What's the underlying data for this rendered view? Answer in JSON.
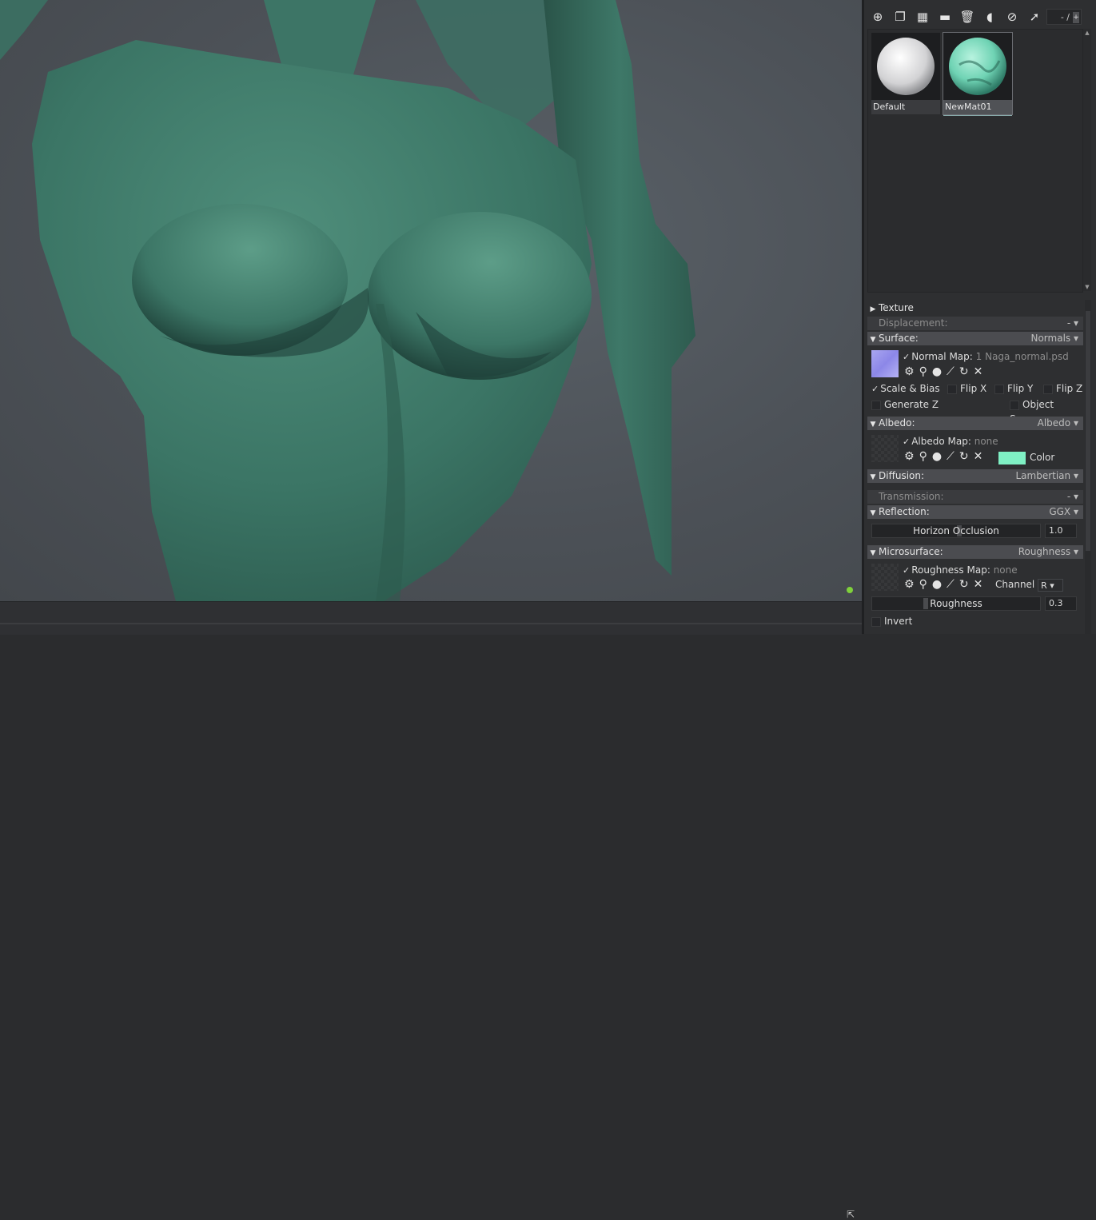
{
  "viewport": {
    "status_color": "#7fd13b",
    "popout_icon": "popout-icon"
  },
  "materials_panel": {
    "toolbar": {
      "icons": [
        "add-material-icon",
        "duplicate-icon",
        "checker-icon",
        "folder-icon",
        "trash-icon",
        "select-object-icon",
        "apply-icon",
        "export-icon"
      ],
      "counter": "- /",
      "counter_plus": "+"
    },
    "materials": [
      {
        "name": "Default",
        "selected": false
      },
      {
        "name": "NewMat01",
        "selected": true
      }
    ]
  },
  "properties": {
    "texture": {
      "label": "Texture"
    },
    "displacement": {
      "label": "Displacement:",
      "value": "-"
    },
    "surface": {
      "label": "Surface:",
      "value": "Normals",
      "normal_map_label": "Normal Map:",
      "normal_map_file": "1 Naga_normal.psd",
      "scale_bias": "Scale & Bias",
      "flip_x": "Flip X",
      "flip_y": "Flip Y",
      "flip_z": "Flip Z",
      "generate_z": "Generate Z",
      "object_space": "Object Space"
    },
    "albedo": {
      "label": "Albedo:",
      "value": "Albedo",
      "map_label": "Albedo Map:",
      "map_file": "none",
      "color_label": "Color",
      "color": "#7ff0c4"
    },
    "diffusion": {
      "label": "Diffusion:",
      "value": "Lambertian"
    },
    "transmission": {
      "label": "Transmission:",
      "value": "-"
    },
    "reflection": {
      "label": "Reflection:",
      "value": "GGX",
      "horizon_occlusion_label": "Horizon Occlusion",
      "horizon_occlusion": "1.0"
    },
    "microsurface": {
      "label": "Microsurface:",
      "value": "Roughness",
      "map_label": "Roughness Map:",
      "map_file": "none",
      "channel_label": "Channel",
      "channel": "R",
      "roughness_label": "Roughness",
      "roughness": "0.3",
      "invert": "Invert"
    }
  }
}
